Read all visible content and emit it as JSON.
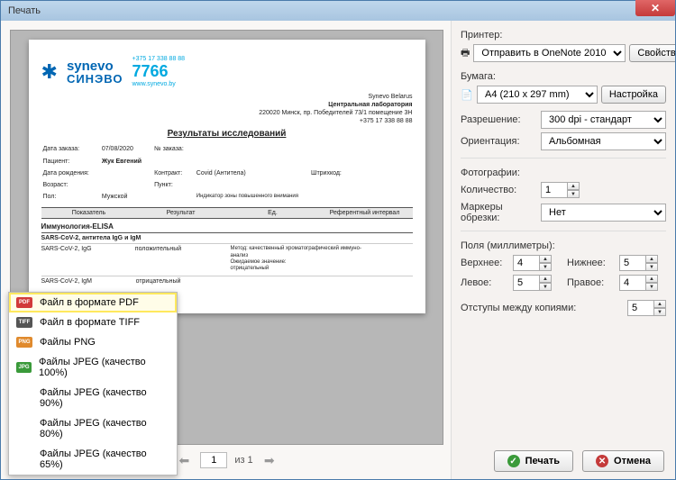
{
  "window": {
    "title": "Печать"
  },
  "preview": {
    "logo_top": "synevo",
    "logo_bottom": "СИНЭВО",
    "phone_small": "+375 17 338 88 88",
    "phone_big": "7766",
    "phone_url": "www.synevo.by",
    "addr1": "Synevo Belarus",
    "addr2": "Центральная лаборатория",
    "addr3": "220020 Минск, пр. Победителей 73/1 помещение 3Н",
    "addr4": "+375 17 338 88 88",
    "results_title": "Результаты исследований",
    "order_date_lbl": "Дата заказа:",
    "order_date": "07/08/2020",
    "order_no_lbl": "№ заказа:",
    "patient_lbl": "Пациент:",
    "patient": "Жук Евгений",
    "dob_lbl": "Дата рождения:",
    "contract_lbl": "Контракт:",
    "contract": "Covid (Антитела)",
    "barcode_lbl": "Штрихкод:",
    "age_lbl": "Возраст:",
    "point_lbl": "Пункт:",
    "sex_lbl": "Пол:",
    "sex": "Мужской",
    "indicator_note": "Индикатор зоны повышенного внимания",
    "col1": "Показатель",
    "col2": "Результат",
    "col3": "Ед.",
    "col4": "Референтный интервал",
    "section": "Иммунология-ELISA",
    "subsection": "SARS-CoV-2, антитела IgG и IgM",
    "row1_name": "SARS-CoV-2, IgG",
    "row1_res": "положительный",
    "row1_note": "Метод: качественный хроматографический иммуно-\nанализ\nОжидаемое значение:\nотрицательный",
    "row2_name": "SARS-CoV-2, IgM",
    "row2_res": "отрицательный"
  },
  "pager": {
    "page": "1",
    "of": "из 1"
  },
  "export": {
    "pdf": "Файл в формате PDF",
    "tiff": "Файл в формате TIFF",
    "png": "Файлы PNG",
    "j100": "Файлы JPEG (качество 100%)",
    "j90": "Файлы JPEG (качество 90%)",
    "j80": "Файлы JPEG (качество 80%)",
    "j65": "Файлы JPEG (качество 65%)"
  },
  "settings": {
    "printer_lbl": "Принтер:",
    "printer_val": "Отправить в OneNote 2010",
    "props_btn": "Свойства",
    "paper_lbl": "Бумага:",
    "paper_val": "A4 (210 x 297 mm)",
    "paper_btn": "Настройка",
    "res_lbl": "Разрешение:",
    "res_val": "300 dpi - стандарт",
    "orient_lbl": "Ориентация:",
    "orient_val": "Альбомная",
    "photos_lbl": "Фотографии:",
    "qty_lbl": "Количество:",
    "qty": "1",
    "crop_lbl": "Маркеры обрезки:",
    "crop": "Нет",
    "margins_lbl": "Поля (миллиметры):",
    "top_lbl": "Верхнее:",
    "top": "4",
    "bottom_lbl": "Нижнее:",
    "bottom": "5",
    "left_lbl": "Левое:",
    "left": "5",
    "right_lbl": "Правое:",
    "right": "4",
    "gap_lbl": "Отступы между копиями:",
    "gap": "5",
    "print_btn": "Печать",
    "cancel_btn": "Отмена"
  }
}
